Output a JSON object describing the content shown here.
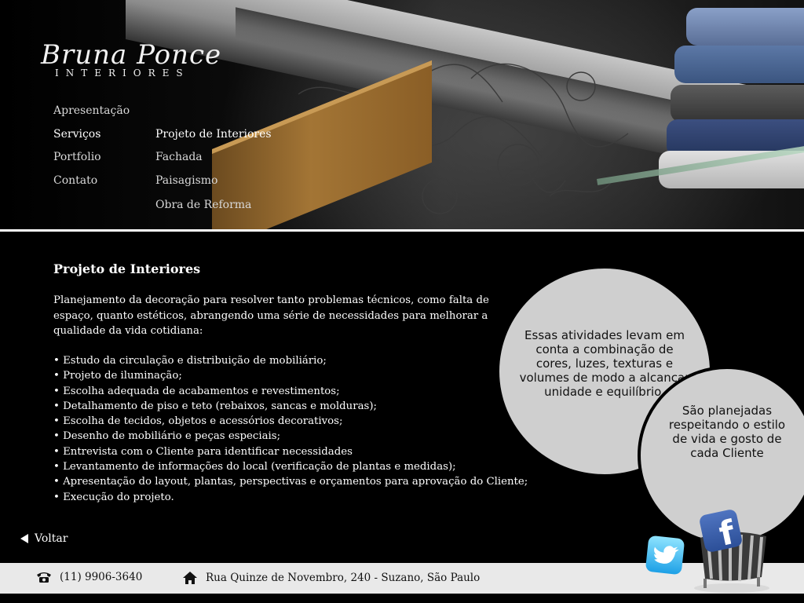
{
  "brand": {
    "logo_script": "Bruna Ponce",
    "logo_sub": "INTERIORES"
  },
  "nav": {
    "main": [
      {
        "label": "Apresentação"
      },
      {
        "label": "Serviços"
      },
      {
        "label": "Portfolio"
      },
      {
        "label": "Contato"
      }
    ],
    "sub": [
      {
        "label": "Projeto de Interiores"
      },
      {
        "label": "Fachada"
      },
      {
        "label": "Paisagismo"
      },
      {
        "label": "Obra de Reforma"
      }
    ]
  },
  "content": {
    "title": "Projeto de Interiores",
    "intro": "Planejamento da decoração para resolver tanto problemas técnicos, como falta de espaço, quanto estéticos, abrangendo uma série de necessidades para melhorar a qualidade da vida cotidiana:",
    "bullets": [
      "• Estudo da circulação e distribuição de mobiliário;",
      "• Projeto de iluminação;",
      "• Escolha adequada de acabamentos e revestimentos;",
      "• Detalhamento de piso e teto (rebaixos, sancas e molduras);",
      "• Escolha de tecidos, objetos e acessórios decorativos;",
      "• Desenho de mobiliário e peças especiais;",
      "• Entrevista com o Cliente para identificar necessidades",
      "• Levantamento de informações do local (verificação de plantas e medidas);",
      "• Apresentação do layout, plantas, perspectivas e orçamentos para aprovação do Cliente;",
      "• Execução do projeto."
    ]
  },
  "bubbles": {
    "first": "Essas atividades levam em conta a combinação de cores, luzes, texturas e volumes de modo a alcançar unidade e equilíbrio.",
    "second": "São planejadas respeitando o estilo de vida e gosto de cada Cliente"
  },
  "back_link": {
    "label": "Voltar",
    "icon": "triangle-left-icon"
  },
  "footer": {
    "phone": "(11) 9906-3640",
    "phone_icon": "phone-icon",
    "address": "Rua Quinze de Novembro, 240 - Suzano, São Paulo",
    "address_icon": "home-icon"
  },
  "social": {
    "facebook_letter": "f",
    "facebook_icon": "facebook-icon",
    "twitter_icon": "twitter-icon"
  },
  "colors": {
    "background": "#000000",
    "bubble": "#cfcfcf",
    "footer": "#e9e9e9",
    "facebook": "#3b5998",
    "twitter": "#1da0e6"
  }
}
